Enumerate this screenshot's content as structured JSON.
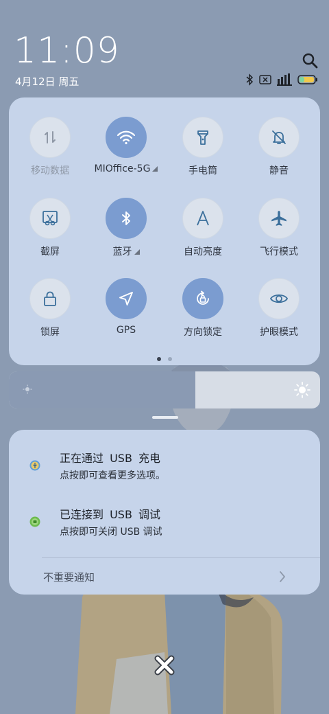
{
  "status": {
    "time": "11:09",
    "date": "4月12日 周五",
    "icons": [
      "bluetooth-icon",
      "no-sim-icon",
      "signal-icon",
      "battery-icon"
    ]
  },
  "quick_settings": {
    "tiles": [
      {
        "label": "移动数据",
        "icon": "mobile-data-icon",
        "active": false
      },
      {
        "label": "MIOffice-5G",
        "icon": "wifi-icon",
        "active": true,
        "expandable": true
      },
      {
        "label": "手电筒",
        "icon": "flashlight-icon",
        "active": false
      },
      {
        "label": "静音",
        "icon": "mute-icon",
        "active": false
      },
      {
        "label": "截屏",
        "icon": "screenshot-icon",
        "active": false
      },
      {
        "label": "蓝牙",
        "icon": "bluetooth-icon",
        "active": true,
        "expandable": true
      },
      {
        "label": "自动亮度",
        "icon": "auto-brightness-icon",
        "active": false
      },
      {
        "label": "飞行模式",
        "icon": "airplane-icon",
        "active": false
      },
      {
        "label": "锁屏",
        "icon": "lock-icon",
        "active": false
      },
      {
        "label": "GPS",
        "icon": "gps-icon",
        "active": true
      },
      {
        "label": "方向锁定",
        "icon": "rotation-lock-icon",
        "active": true
      },
      {
        "label": "护眼模式",
        "icon": "eye-icon",
        "active": false
      }
    ],
    "page_count": 2,
    "current_page": 1
  },
  "brightness": {
    "level": 0.6
  },
  "notifications": {
    "items": [
      {
        "title": "正在通过 USB 充电",
        "subtitle": "点按即可查看更多选项。",
        "icon": "usb-icon"
      },
      {
        "title": "已连接到 USB 调试",
        "subtitle": "点按即可关闭 USB 调试",
        "icon": "android-debug-icon"
      }
    ],
    "footer_label": "不重要通知"
  },
  "colors": {
    "panel": "#c6d4ea",
    "tile_on": "#7b9cd0",
    "tile_off": "#dbe2ec",
    "accent_icon": "#3b6f9b"
  }
}
